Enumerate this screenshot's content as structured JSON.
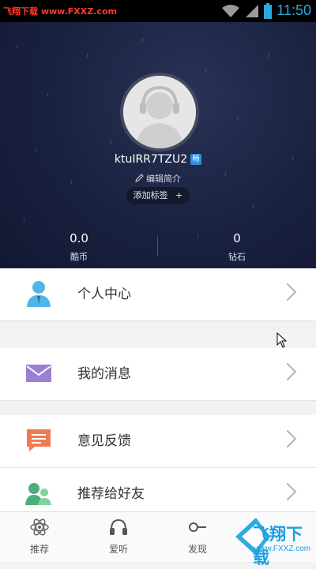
{
  "status_bar": {
    "watermark": "飞翔下载 www.FXXZ.com",
    "time": "11:50"
  },
  "profile": {
    "username": "ktuIRR7TZU2",
    "badge": "畅",
    "edit_bio": "编辑简介",
    "add_tag": "添加标签",
    "add_tag_plus": "+",
    "stats": [
      {
        "value": "0.0",
        "label": "酷币"
      },
      {
        "value": "0",
        "label": "钻石"
      }
    ]
  },
  "menu": {
    "items": [
      {
        "label": "个人中心",
        "icon": "person-icon",
        "color": "#4fb6e8"
      },
      {
        "label": "我的消息",
        "icon": "envelope-icon",
        "color": "#9b7fd4"
      },
      {
        "label": "意见反馈",
        "icon": "feedback-icon",
        "color": "#f07b4f"
      },
      {
        "label": "推荐给好友",
        "icon": "friends-icon",
        "color": "#4caf7a"
      }
    ]
  },
  "tabbar": {
    "tabs": [
      {
        "label": "推荐",
        "icon": "atom-icon"
      },
      {
        "label": "爱听",
        "icon": "headphones-icon"
      },
      {
        "label": "发现",
        "icon": "discover-icon"
      }
    ]
  },
  "watermark": {
    "brand": "飞翔下载",
    "url": "www.FXXZ.com"
  }
}
